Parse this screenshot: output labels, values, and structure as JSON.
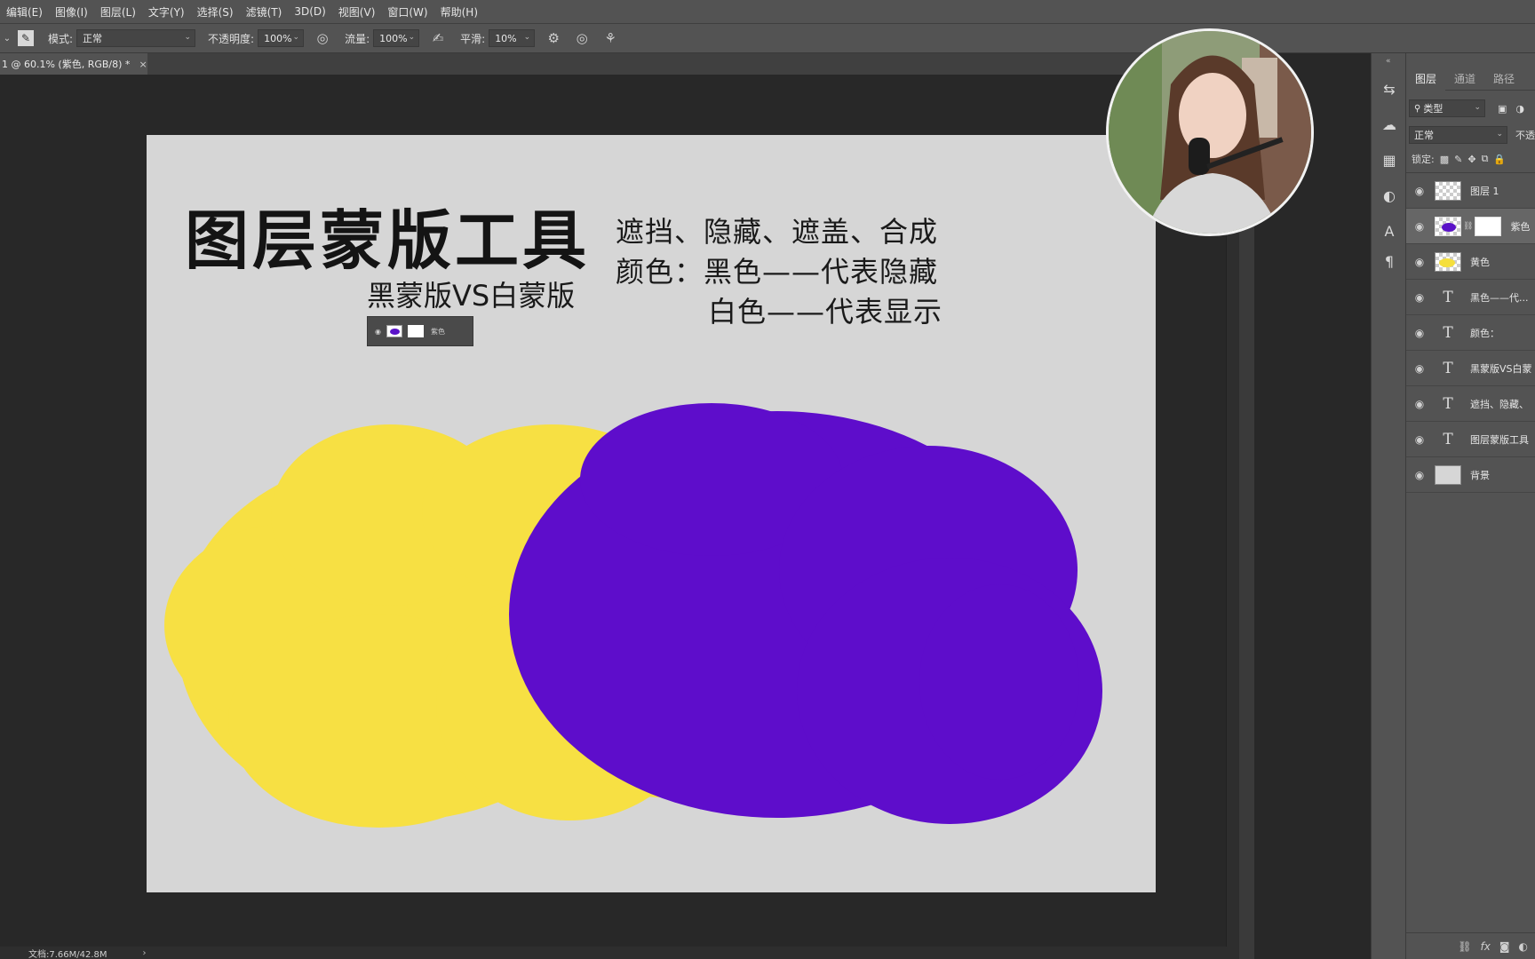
{
  "menu": [
    "编辑(E)",
    "图像(I)",
    "图层(L)",
    "文字(Y)",
    "选择(S)",
    "滤镜(T)",
    "3D(D)",
    "视图(V)",
    "窗口(W)",
    "帮助(H)"
  ],
  "options": {
    "mode_label": "模式:",
    "mode_value": "正常",
    "opacity_label": "不透明度:",
    "opacity_value": "100%",
    "flow_label": "流量:",
    "flow_value": "100%",
    "smoothing_label": "平滑:",
    "smoothing_value": "10%"
  },
  "document": {
    "tab_title": "1 @ 60.1% (紫色, RGB/8) *",
    "close_glyph": "×"
  },
  "canvas": {
    "title": "图层蒙版工具",
    "subtitle": "黑蒙版VS白蒙版",
    "desc_line1": "遮挡、隐藏、遮盖、合成",
    "desc_line2": "颜色：黑色——代表隐藏",
    "desc_line3": "白色——代表显示",
    "mini_layer_name": "紫色",
    "colors": {
      "background": "#d6d6d6",
      "yellow": "#f7e043",
      "purple": "#5e0dcb"
    }
  },
  "status": {
    "doc_info": "文档:7.66M/42.8M",
    "arrow": "›"
  },
  "layers_panel": {
    "tabs": [
      "图层",
      "通道",
      "路径"
    ],
    "filter_label": "类型",
    "blend_mode": "正常",
    "opacity_label": "不透",
    "lock_label": "锁定:",
    "layers": [
      {
        "name": "图层 1",
        "kind": "pixel-empty"
      },
      {
        "name": "紫色",
        "kind": "pixel-purple-masked",
        "selected": true
      },
      {
        "name": "黄色",
        "kind": "pixel-yellow"
      },
      {
        "name": "黑色——代...",
        "kind": "text"
      },
      {
        "name": "颜色：",
        "kind": "text"
      },
      {
        "name": "黑蒙版VS白蒙",
        "kind": "text"
      },
      {
        "name": "遮挡、隐藏、",
        "kind": "text"
      },
      {
        "name": "图层蒙版工具",
        "kind": "text"
      },
      {
        "name": "背景",
        "kind": "background"
      }
    ],
    "footer_icons": [
      "link-icon",
      "fx-icon",
      "add-mask-icon",
      "adjustment-icon"
    ]
  }
}
